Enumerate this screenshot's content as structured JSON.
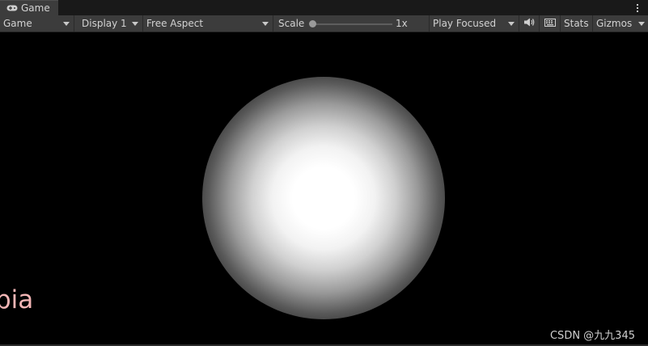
{
  "tab": {
    "title": "Game",
    "icon": "gamepad-icon"
  },
  "toolbar": {
    "view_select": "Game",
    "display_select": "Display 1",
    "aspect_select": "Free Aspect",
    "scale_label": "Scale",
    "scale_value": "1x",
    "play_mode": "Play Focused",
    "audio_icon": "speaker-icon",
    "keyboard_icon": "keyboard-icon",
    "stats_label": "Stats",
    "gizmos_label": "Gizmos",
    "menu_icon": "kebab-menu-icon"
  },
  "viewport": {
    "partial_text": "bia",
    "watermark": "CSDN @九九345"
  },
  "colors": {
    "toolbar_bg": "#3c3c3c",
    "viewport_bg": "#000000",
    "partial_text": "#f4b6b6"
  }
}
